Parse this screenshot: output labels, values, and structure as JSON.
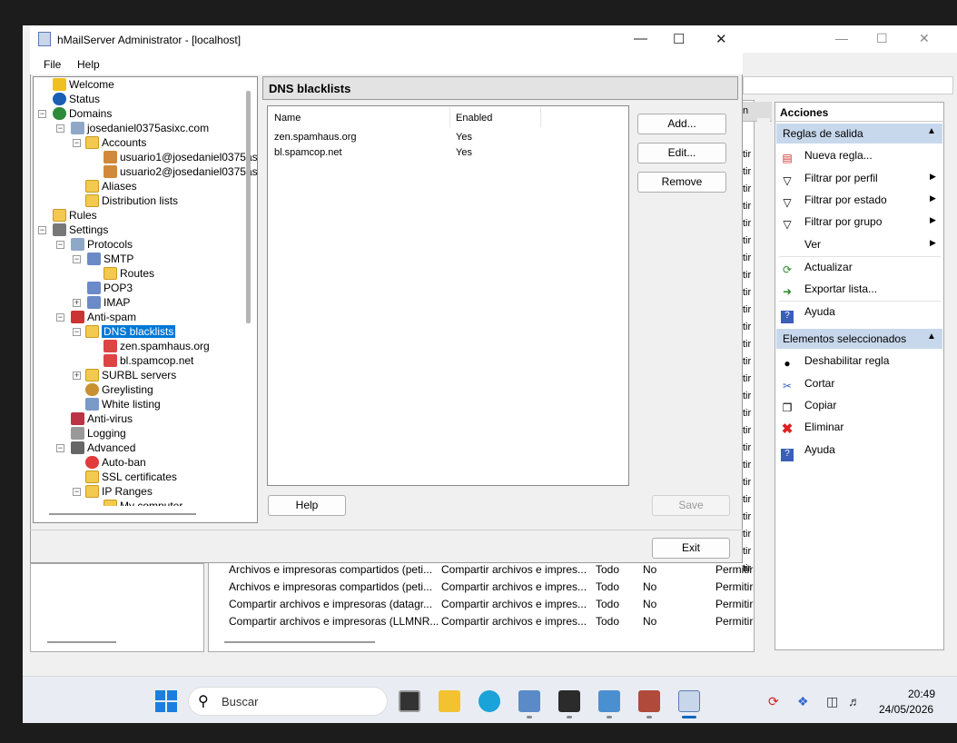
{
  "window": {
    "title": "hMailServer Administrator - [localhost]"
  },
  "menu": [
    "File",
    "Help"
  ],
  "tree": [
    {
      "label": "Welcome"
    },
    {
      "label": "Status"
    },
    {
      "label": "Domains"
    },
    {
      "label": "josedaniel0375asixc.com"
    },
    {
      "label": "Accounts"
    },
    {
      "label": "usuario1@josedaniel0375as"
    },
    {
      "label": "usuario2@josedaniel0375as"
    },
    {
      "label": "Aliases"
    },
    {
      "label": "Distribution lists"
    },
    {
      "label": "Rules"
    },
    {
      "label": "Settings"
    },
    {
      "label": "Protocols"
    },
    {
      "label": "SMTP"
    },
    {
      "label": "Routes"
    },
    {
      "label": "POP3"
    },
    {
      "label": "IMAP"
    },
    {
      "label": "Anti-spam"
    },
    {
      "label": "DNS blacklists"
    },
    {
      "label": "zen.spamhaus.org"
    },
    {
      "label": "bl.spamcop.net"
    },
    {
      "label": "SURBL servers"
    },
    {
      "label": "Greylisting"
    },
    {
      "label": "White listing"
    },
    {
      "label": "Anti-virus"
    },
    {
      "label": "Logging"
    },
    {
      "label": "Advanced"
    },
    {
      "label": "Auto-ban"
    },
    {
      "label": "SSL certificates"
    },
    {
      "label": "IP Ranges"
    },
    {
      "label": "My computer"
    }
  ],
  "panel": {
    "title": "DNS blacklists",
    "columns": [
      "Name",
      "Enabled"
    ],
    "rows": [
      {
        "name": "zen.spamhaus.org",
        "enabled": "Yes"
      },
      {
        "name": "bl.spamcop.net",
        "enabled": "Yes"
      }
    ],
    "buttons": {
      "add": "Add...",
      "edit": "Edit...",
      "remove": "Remove",
      "help": "Help",
      "save": "Save",
      "exit": "Exit"
    }
  },
  "background": {
    "list_header_fragment": "n",
    "permit_fragment": "tir",
    "rows": [
      {
        "c1": "Archivos e impresoras compartidos (peti...",
        "c2": "Compartir archivos e impres...",
        "c3": "Todo",
        "c4": "No",
        "c5": "Permitir"
      },
      {
        "c1": "Archivos e impresoras compartidos (peti...",
        "c2": "Compartir archivos e impres...",
        "c3": "Todo",
        "c4": "No",
        "c5": "Permitir"
      },
      {
        "c1": "Compartir archivos e impresoras (datagr...",
        "c2": "Compartir archivos e impres...",
        "c3": "Todo",
        "c4": "No",
        "c5": "Permitir"
      },
      {
        "c1": "Compartir archivos e impresoras (LLMNR...",
        "c2": "Compartir archivos e impres...",
        "c3": "Todo",
        "c4": "No",
        "c5": "Permitir"
      }
    ]
  },
  "actions": {
    "title": "Acciones",
    "section1": "Reglas de salida",
    "items1": [
      "Nueva regla...",
      "Filtrar por perfil",
      "Filtrar por estado",
      "Filtrar por grupo",
      "Ver",
      "Actualizar",
      "Exportar lista...",
      "Ayuda"
    ],
    "section2": "Elementos seleccionados",
    "items2": [
      "Deshabilitar regla",
      "Cortar",
      "Copiar",
      "Eliminar",
      "Ayuda"
    ]
  },
  "taskbar": {
    "search_placeholder": "Buscar",
    "time": "20:49",
    "date": "24/05/2026"
  },
  "colors": {
    "selection": "#0078d7",
    "section_bg": "#c8d8ec"
  }
}
